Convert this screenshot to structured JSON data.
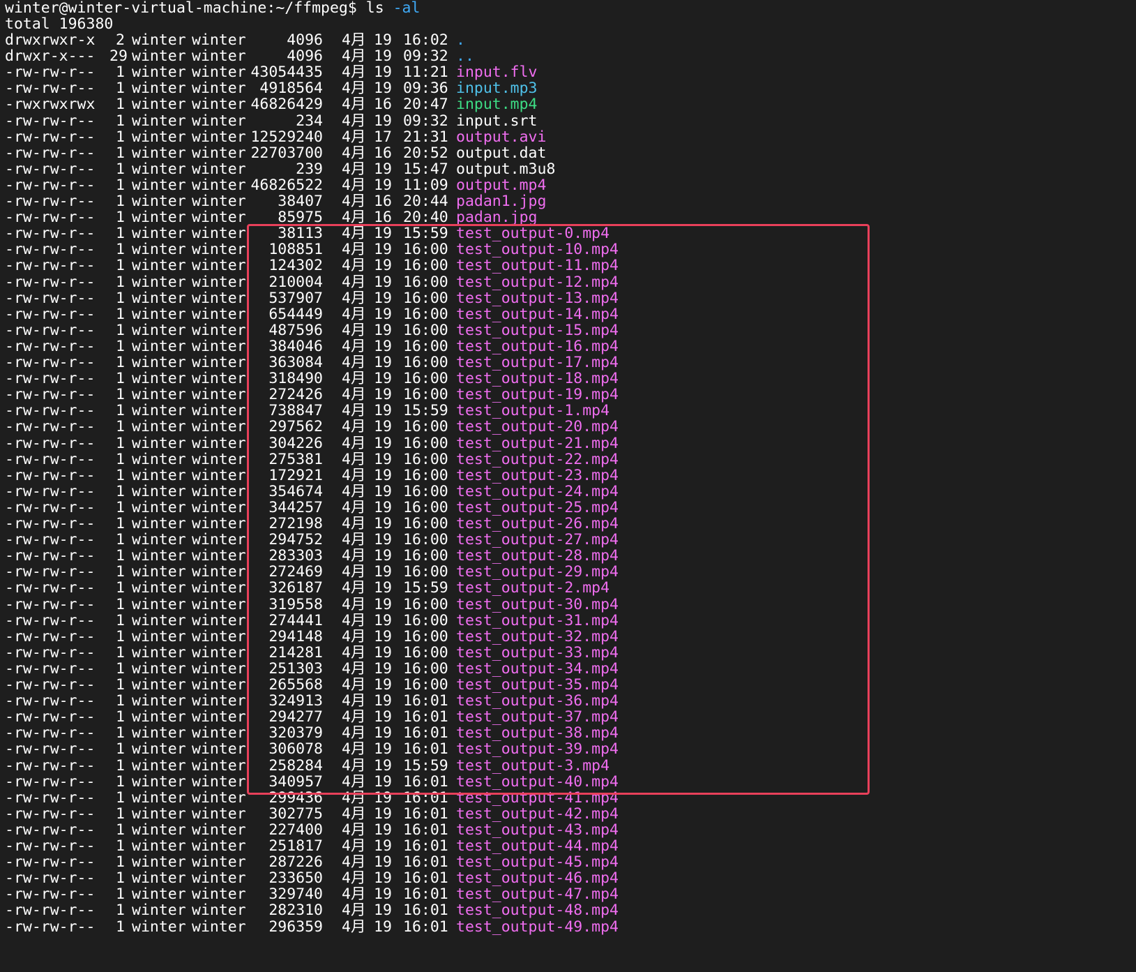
{
  "terminal": {
    "prompt": "winter@winter-virtual-machine:~/ffmpeg$ ",
    "command": "ls",
    "command_arg": "-al",
    "total_line": "total 196380"
  },
  "colors": {
    "background": "#1e1e1e",
    "default_text": "#ffffff",
    "directory": "#3fa9f5",
    "audio": "#4fc1e9",
    "executable": "#3ddc84",
    "media": "#f06ef0",
    "highlight_border": "#e8405a"
  },
  "entries": [
    {
      "perm": "drwxrwxr-x",
      "links": "2",
      "owner": "winter",
      "group": "winter",
      "size": "4096",
      "month": "4月",
      "day": "19",
      "time": "16:02",
      "name": ".",
      "color": "directory"
    },
    {
      "perm": "drwxr-x---",
      "links": "29",
      "owner": "winter",
      "group": "winter",
      "size": "4096",
      "month": "4月",
      "day": "19",
      "time": "09:32",
      "name": "..",
      "color": "directory"
    },
    {
      "perm": "-rw-rw-r--",
      "links": "1",
      "owner": "winter",
      "group": "winter",
      "size": "43054435",
      "month": "4月",
      "day": "19",
      "time": "11:21",
      "name": "input.flv",
      "color": "media"
    },
    {
      "perm": "-rw-rw-r--",
      "links": "1",
      "owner": "winter",
      "group": "winter",
      "size": "4918564",
      "month": "4月",
      "day": "19",
      "time": "09:36",
      "name": "input.mp3",
      "color": "audio"
    },
    {
      "perm": "-rwxrwxrwx",
      "links": "1",
      "owner": "winter",
      "group": "winter",
      "size": "46826429",
      "month": "4月",
      "day": "16",
      "time": "20:47",
      "name": "input.mp4",
      "color": "executable"
    },
    {
      "perm": "-rw-rw-r--",
      "links": "1",
      "owner": "winter",
      "group": "winter",
      "size": "234",
      "month": "4月",
      "day": "19",
      "time": "09:32",
      "name": "input.srt",
      "color": "default_text"
    },
    {
      "perm": "-rw-rw-r--",
      "links": "1",
      "owner": "winter",
      "group": "winter",
      "size": "12529240",
      "month": "4月",
      "day": "17",
      "time": "21:31",
      "name": "output.avi",
      "color": "media"
    },
    {
      "perm": "-rw-rw-r--",
      "links": "1",
      "owner": "winter",
      "group": "winter",
      "size": "22703700",
      "month": "4月",
      "day": "16",
      "time": "20:52",
      "name": "output.dat",
      "color": "default_text"
    },
    {
      "perm": "-rw-rw-r--",
      "links": "1",
      "owner": "winter",
      "group": "winter",
      "size": "239",
      "month": "4月",
      "day": "19",
      "time": "15:47",
      "name": "output.m3u8",
      "color": "default_text"
    },
    {
      "perm": "-rw-rw-r--",
      "links": "1",
      "owner": "winter",
      "group": "winter",
      "size": "46826522",
      "month": "4月",
      "day": "19",
      "time": "11:09",
      "name": "output.mp4",
      "color": "media"
    },
    {
      "perm": "-rw-rw-r--",
      "links": "1",
      "owner": "winter",
      "group": "winter",
      "size": "38407",
      "month": "4月",
      "day": "16",
      "time": "20:44",
      "name": "padan1.jpg",
      "color": "media"
    },
    {
      "perm": "-rw-rw-r--",
      "links": "1",
      "owner": "winter",
      "group": "winter",
      "size": "85975",
      "month": "4月",
      "day": "16",
      "time": "20:40",
      "name": "padan.jpg",
      "color": "media"
    },
    {
      "perm": "-rw-rw-r--",
      "links": "1",
      "owner": "winter",
      "group": "winter",
      "size": "38113",
      "month": "4月",
      "day": "19",
      "time": "15:59",
      "name": "test_output-0.mp4",
      "color": "media"
    },
    {
      "perm": "-rw-rw-r--",
      "links": "1",
      "owner": "winter",
      "group": "winter",
      "size": "108851",
      "month": "4月",
      "day": "19",
      "time": "16:00",
      "name": "test_output-10.mp4",
      "color": "media"
    },
    {
      "perm": "-rw-rw-r--",
      "links": "1",
      "owner": "winter",
      "group": "winter",
      "size": "124302",
      "month": "4月",
      "day": "19",
      "time": "16:00",
      "name": "test_output-11.mp4",
      "color": "media"
    },
    {
      "perm": "-rw-rw-r--",
      "links": "1",
      "owner": "winter",
      "group": "winter",
      "size": "210004",
      "month": "4月",
      "day": "19",
      "time": "16:00",
      "name": "test_output-12.mp4",
      "color": "media"
    },
    {
      "perm": "-rw-rw-r--",
      "links": "1",
      "owner": "winter",
      "group": "winter",
      "size": "537907",
      "month": "4月",
      "day": "19",
      "time": "16:00",
      "name": "test_output-13.mp4",
      "color": "media"
    },
    {
      "perm": "-rw-rw-r--",
      "links": "1",
      "owner": "winter",
      "group": "winter",
      "size": "654449",
      "month": "4月",
      "day": "19",
      "time": "16:00",
      "name": "test_output-14.mp4",
      "color": "media"
    },
    {
      "perm": "-rw-rw-r--",
      "links": "1",
      "owner": "winter",
      "group": "winter",
      "size": "487596",
      "month": "4月",
      "day": "19",
      "time": "16:00",
      "name": "test_output-15.mp4",
      "color": "media"
    },
    {
      "perm": "-rw-rw-r--",
      "links": "1",
      "owner": "winter",
      "group": "winter",
      "size": "384046",
      "month": "4月",
      "day": "19",
      "time": "16:00",
      "name": "test_output-16.mp4",
      "color": "media"
    },
    {
      "perm": "-rw-rw-r--",
      "links": "1",
      "owner": "winter",
      "group": "winter",
      "size": "363084",
      "month": "4月",
      "day": "19",
      "time": "16:00",
      "name": "test_output-17.mp4",
      "color": "media"
    },
    {
      "perm": "-rw-rw-r--",
      "links": "1",
      "owner": "winter",
      "group": "winter",
      "size": "318490",
      "month": "4月",
      "day": "19",
      "time": "16:00",
      "name": "test_output-18.mp4",
      "color": "media"
    },
    {
      "perm": "-rw-rw-r--",
      "links": "1",
      "owner": "winter",
      "group": "winter",
      "size": "272426",
      "month": "4月",
      "day": "19",
      "time": "16:00",
      "name": "test_output-19.mp4",
      "color": "media"
    },
    {
      "perm": "-rw-rw-r--",
      "links": "1",
      "owner": "winter",
      "group": "winter",
      "size": "738847",
      "month": "4月",
      "day": "19",
      "time": "15:59",
      "name": "test_output-1.mp4",
      "color": "media"
    },
    {
      "perm": "-rw-rw-r--",
      "links": "1",
      "owner": "winter",
      "group": "winter",
      "size": "297562",
      "month": "4月",
      "day": "19",
      "time": "16:00",
      "name": "test_output-20.mp4",
      "color": "media"
    },
    {
      "perm": "-rw-rw-r--",
      "links": "1",
      "owner": "winter",
      "group": "winter",
      "size": "304226",
      "month": "4月",
      "day": "19",
      "time": "16:00",
      "name": "test_output-21.mp4",
      "color": "media"
    },
    {
      "perm": "-rw-rw-r--",
      "links": "1",
      "owner": "winter",
      "group": "winter",
      "size": "275381",
      "month": "4月",
      "day": "19",
      "time": "16:00",
      "name": "test_output-22.mp4",
      "color": "media"
    },
    {
      "perm": "-rw-rw-r--",
      "links": "1",
      "owner": "winter",
      "group": "winter",
      "size": "172921",
      "month": "4月",
      "day": "19",
      "time": "16:00",
      "name": "test_output-23.mp4",
      "color": "media"
    },
    {
      "perm": "-rw-rw-r--",
      "links": "1",
      "owner": "winter",
      "group": "winter",
      "size": "354674",
      "month": "4月",
      "day": "19",
      "time": "16:00",
      "name": "test_output-24.mp4",
      "color": "media"
    },
    {
      "perm": "-rw-rw-r--",
      "links": "1",
      "owner": "winter",
      "group": "winter",
      "size": "344257",
      "month": "4月",
      "day": "19",
      "time": "16:00",
      "name": "test_output-25.mp4",
      "color": "media"
    },
    {
      "perm": "-rw-rw-r--",
      "links": "1",
      "owner": "winter",
      "group": "winter",
      "size": "272198",
      "month": "4月",
      "day": "19",
      "time": "16:00",
      "name": "test_output-26.mp4",
      "color": "media"
    },
    {
      "perm": "-rw-rw-r--",
      "links": "1",
      "owner": "winter",
      "group": "winter",
      "size": "294752",
      "month": "4月",
      "day": "19",
      "time": "16:00",
      "name": "test_output-27.mp4",
      "color": "media"
    },
    {
      "perm": "-rw-rw-r--",
      "links": "1",
      "owner": "winter",
      "group": "winter",
      "size": "283303",
      "month": "4月",
      "day": "19",
      "time": "16:00",
      "name": "test_output-28.mp4",
      "color": "media"
    },
    {
      "perm": "-rw-rw-r--",
      "links": "1",
      "owner": "winter",
      "group": "winter",
      "size": "272469",
      "month": "4月",
      "day": "19",
      "time": "16:00",
      "name": "test_output-29.mp4",
      "color": "media"
    },
    {
      "perm": "-rw-rw-r--",
      "links": "1",
      "owner": "winter",
      "group": "winter",
      "size": "326187",
      "month": "4月",
      "day": "19",
      "time": "15:59",
      "name": "test_output-2.mp4",
      "color": "media"
    },
    {
      "perm": "-rw-rw-r--",
      "links": "1",
      "owner": "winter",
      "group": "winter",
      "size": "319558",
      "month": "4月",
      "day": "19",
      "time": "16:00",
      "name": "test_output-30.mp4",
      "color": "media"
    },
    {
      "perm": "-rw-rw-r--",
      "links": "1",
      "owner": "winter",
      "group": "winter",
      "size": "274441",
      "month": "4月",
      "day": "19",
      "time": "16:00",
      "name": "test_output-31.mp4",
      "color": "media"
    },
    {
      "perm": "-rw-rw-r--",
      "links": "1",
      "owner": "winter",
      "group": "winter",
      "size": "294148",
      "month": "4月",
      "day": "19",
      "time": "16:00",
      "name": "test_output-32.mp4",
      "color": "media"
    },
    {
      "perm": "-rw-rw-r--",
      "links": "1",
      "owner": "winter",
      "group": "winter",
      "size": "214281",
      "month": "4月",
      "day": "19",
      "time": "16:00",
      "name": "test_output-33.mp4",
      "color": "media"
    },
    {
      "perm": "-rw-rw-r--",
      "links": "1",
      "owner": "winter",
      "group": "winter",
      "size": "251303",
      "month": "4月",
      "day": "19",
      "time": "16:00",
      "name": "test_output-34.mp4",
      "color": "media"
    },
    {
      "perm": "-rw-rw-r--",
      "links": "1",
      "owner": "winter",
      "group": "winter",
      "size": "265568",
      "month": "4月",
      "day": "19",
      "time": "16:00",
      "name": "test_output-35.mp4",
      "color": "media"
    },
    {
      "perm": "-rw-rw-r--",
      "links": "1",
      "owner": "winter",
      "group": "winter",
      "size": "324913",
      "month": "4月",
      "day": "19",
      "time": "16:01",
      "name": "test_output-36.mp4",
      "color": "media"
    },
    {
      "perm": "-rw-rw-r--",
      "links": "1",
      "owner": "winter",
      "group": "winter",
      "size": "294277",
      "month": "4月",
      "day": "19",
      "time": "16:01",
      "name": "test_output-37.mp4",
      "color": "media"
    },
    {
      "perm": "-rw-rw-r--",
      "links": "1",
      "owner": "winter",
      "group": "winter",
      "size": "320379",
      "month": "4月",
      "day": "19",
      "time": "16:01",
      "name": "test_output-38.mp4",
      "color": "media"
    },
    {
      "perm": "-rw-rw-r--",
      "links": "1",
      "owner": "winter",
      "group": "winter",
      "size": "306078",
      "month": "4月",
      "day": "19",
      "time": "16:01",
      "name": "test_output-39.mp4",
      "color": "media"
    },
    {
      "perm": "-rw-rw-r--",
      "links": "1",
      "owner": "winter",
      "group": "winter",
      "size": "258284",
      "month": "4月",
      "day": "19",
      "time": "15:59",
      "name": "test_output-3.mp4",
      "color": "media"
    },
    {
      "perm": "-rw-rw-r--",
      "links": "1",
      "owner": "winter",
      "group": "winter",
      "size": "340957",
      "month": "4月",
      "day": "19",
      "time": "16:01",
      "name": "test_output-40.mp4",
      "color": "media"
    },
    {
      "perm": "-rw-rw-r--",
      "links": "1",
      "owner": "winter",
      "group": "winter",
      "size": "299436",
      "month": "4月",
      "day": "19",
      "time": "16:01",
      "name": "test_output-41.mp4",
      "color": "media"
    },
    {
      "perm": "-rw-rw-r--",
      "links": "1",
      "owner": "winter",
      "group": "winter",
      "size": "302775",
      "month": "4月",
      "day": "19",
      "time": "16:01",
      "name": "test_output-42.mp4",
      "color": "media"
    },
    {
      "perm": "-rw-rw-r--",
      "links": "1",
      "owner": "winter",
      "group": "winter",
      "size": "227400",
      "month": "4月",
      "day": "19",
      "time": "16:01",
      "name": "test_output-43.mp4",
      "color": "media"
    },
    {
      "perm": "-rw-rw-r--",
      "links": "1",
      "owner": "winter",
      "group": "winter",
      "size": "251817",
      "month": "4月",
      "day": "19",
      "time": "16:01",
      "name": "test_output-44.mp4",
      "color": "media"
    },
    {
      "perm": "-rw-rw-r--",
      "links": "1",
      "owner": "winter",
      "group": "winter",
      "size": "287226",
      "month": "4月",
      "day": "19",
      "time": "16:01",
      "name": "test_output-45.mp4",
      "color": "media"
    },
    {
      "perm": "-rw-rw-r--",
      "links": "1",
      "owner": "winter",
      "group": "winter",
      "size": "233650",
      "month": "4月",
      "day": "19",
      "time": "16:01",
      "name": "test_output-46.mp4",
      "color": "media"
    },
    {
      "perm": "-rw-rw-r--",
      "links": "1",
      "owner": "winter",
      "group": "winter",
      "size": "329740",
      "month": "4月",
      "day": "19",
      "time": "16:01",
      "name": "test_output-47.mp4",
      "color": "media"
    },
    {
      "perm": "-rw-rw-r--",
      "links": "1",
      "owner": "winter",
      "group": "winter",
      "size": "282310",
      "month": "4月",
      "day": "19",
      "time": "16:01",
      "name": "test_output-48.mp4",
      "color": "media"
    },
    {
      "perm": "-rw-rw-r--",
      "links": "1",
      "owner": "winter",
      "group": "winter",
      "size": "296359",
      "month": "4月",
      "day": "19",
      "time": "16:01",
      "name": "test_output-49.mp4",
      "color": "media"
    }
  ]
}
